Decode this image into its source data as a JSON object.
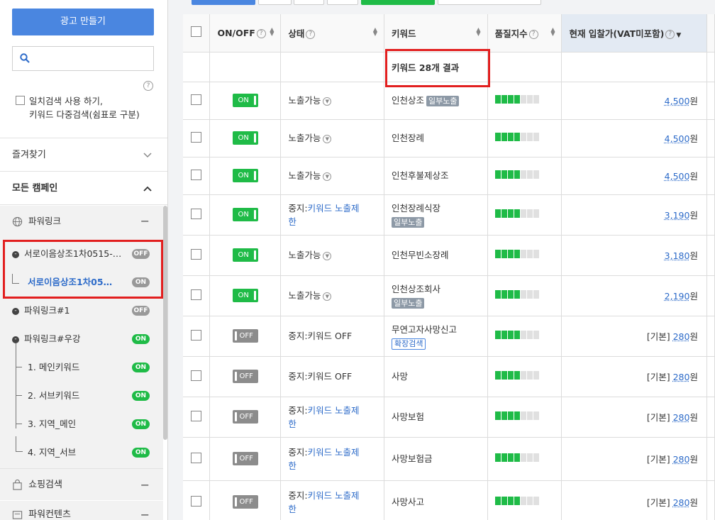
{
  "sidebar": {
    "create_ad_label": "광고 만들기",
    "search_placeholder": "",
    "exact_search_label_line1": "일치검색 사용 하기,",
    "exact_search_label_line2": "키워드 다중검색(쉼표로 구분)",
    "favorites_label": "즐겨찾기",
    "all_campaigns_label": "모든 캠페인",
    "powerlink_group_label": "파워링크",
    "campaigns": [
      {
        "label": "서로이음상조1차0515-…",
        "status": "OFF"
      },
      {
        "label": "서로이음상조1차05…",
        "status": "ON"
      },
      {
        "label": "파워링크#1",
        "status": "OFF"
      },
      {
        "label": "파워링크#우강",
        "status": "ON"
      },
      {
        "label": "1. 메인키워드",
        "status": "ON"
      },
      {
        "label": "2. 서브키워드",
        "status": "ON"
      },
      {
        "label": "3. 지역_메인",
        "status": "ON"
      },
      {
        "label": "4. 지역_서브",
        "status": "ON"
      }
    ],
    "shopping_label": "쇼핑검색",
    "powercontents_label": "파워컨텐츠"
  },
  "table": {
    "headers": {
      "onoff": "ON/OFF",
      "status": "상태",
      "keyword": "키워드",
      "quality": "품질지수",
      "bid": "현재 입찰가(VAT미포함)"
    },
    "result_summary": "키워드 28개 결과",
    "rows": [
      {
        "toggle": "ON",
        "status_prefix": "노출가능",
        "status_link": "",
        "status_tail": "",
        "keyword": "인천상조",
        "badge": "일부노출",
        "badge_block": false,
        "quality": 4,
        "bid_prefix": "",
        "bid": "4,500",
        "unit": "원"
      },
      {
        "toggle": "ON",
        "status_prefix": "노출가능",
        "status_link": "",
        "status_tail": "",
        "keyword": "인천장례",
        "badge": "",
        "badge_block": false,
        "quality": 4,
        "bid_prefix": "",
        "bid": "4,500",
        "unit": "원"
      },
      {
        "toggle": "ON",
        "status_prefix": "노출가능",
        "status_link": "",
        "status_tail": "",
        "keyword": "인천후불제상조",
        "badge": "",
        "badge_block": false,
        "quality": 4,
        "bid_prefix": "",
        "bid": "4,500",
        "unit": "원"
      },
      {
        "toggle": "ON",
        "status_prefix": "중지:",
        "status_link": "키워드 노출제",
        "status_tail": "한",
        "keyword": "인천장례식장",
        "badge": "일부노출",
        "badge_block": true,
        "quality": 4,
        "bid_prefix": "",
        "bid": "3,190",
        "unit": "원"
      },
      {
        "toggle": "ON",
        "status_prefix": "노출가능",
        "status_link": "",
        "status_tail": "",
        "keyword": "인천무빈소장례",
        "badge": "",
        "badge_block": false,
        "quality": 4,
        "bid_prefix": "",
        "bid": "3,180",
        "unit": "원"
      },
      {
        "toggle": "ON",
        "status_prefix": "노출가능",
        "status_link": "",
        "status_tail": "",
        "keyword": "인천상조회사",
        "badge": "일부노출",
        "badge_block": true,
        "quality": 4,
        "bid_prefix": "",
        "bid": "2,190",
        "unit": "원"
      },
      {
        "toggle": "OFF",
        "status_prefix": "중지:키워드 OFF",
        "status_link": "",
        "status_tail": "",
        "keyword": "무연고자사망신고",
        "badge": "확장검색",
        "badge_block": true,
        "quality": 4,
        "bid_prefix": "[기본]",
        "bid": "280",
        "unit": "원"
      },
      {
        "toggle": "OFF",
        "status_prefix": "중지:키워드 OFF",
        "status_link": "",
        "status_tail": "",
        "keyword": "사망",
        "badge": "",
        "badge_block": false,
        "quality": 4,
        "bid_prefix": "[기본]",
        "bid": "280",
        "unit": "원"
      },
      {
        "toggle": "OFF",
        "status_prefix": "중지:",
        "status_link": "키워드 노출제",
        "status_tail": "한",
        "keyword": "사망보험",
        "badge": "",
        "badge_block": false,
        "quality": 4,
        "bid_prefix": "[기본]",
        "bid": "280",
        "unit": "원"
      },
      {
        "toggle": "OFF",
        "status_prefix": "중지:",
        "status_link": "키워드 노출제",
        "status_tail": "한",
        "keyword": "사망보험금",
        "badge": "",
        "badge_block": false,
        "quality": 4,
        "bid_prefix": "[기본]",
        "bid": "280",
        "unit": "원"
      },
      {
        "toggle": "OFF",
        "status_prefix": "중지:",
        "status_link": "키워드 노출제",
        "status_tail": "한",
        "keyword": "사망사고",
        "badge": "",
        "badge_block": false,
        "quality": 4,
        "bid_prefix": "[기본]",
        "bid": "280",
        "unit": "원"
      }
    ]
  },
  "colors": {
    "accent": "#4a86e0",
    "on": "#1fbb47",
    "off": "#8c8c8c",
    "highlight": "#e21f1f",
    "link": "#2d6bc9"
  },
  "icons": {
    "search": "search-icon",
    "help": "help-icon",
    "globe": "globe-icon",
    "bag": "shopping-bag-icon",
    "content": "content-icon"
  }
}
